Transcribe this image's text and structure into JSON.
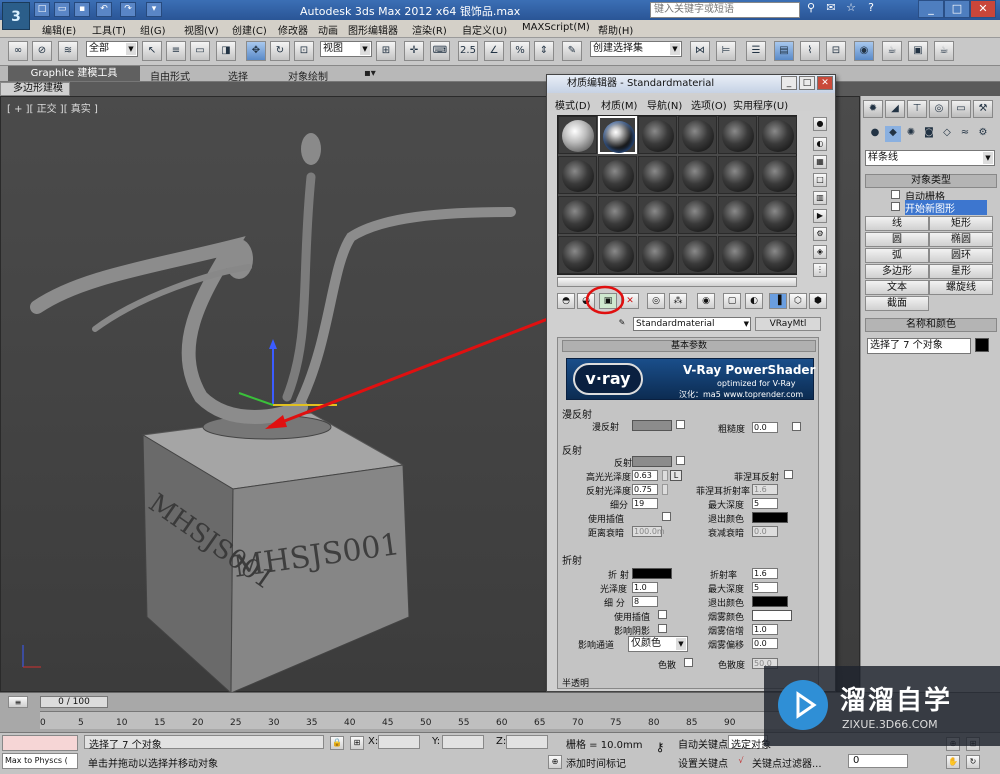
{
  "window": {
    "title": "Autodesk 3ds Max  2012 x64      银饰品.max",
    "search_placeholder": "键入关键字或短语"
  },
  "menu": [
    "编辑(E)",
    "工具(T)",
    "组(G)",
    "视图(V)",
    "创建(C)",
    "修改器",
    "动画",
    "图形编辑器",
    "渲染(R)",
    "自定义(U)",
    "MAXScript(M)",
    "帮助(H)"
  ],
  "toolbar": {
    "filter": "全部",
    "view": "视图",
    "snap_value": "2.5",
    "selection_set": "创建选择集"
  },
  "ribbon": {
    "tabs": [
      "Graphite 建模工具",
      "自由形式",
      "选择",
      "对象绘制"
    ],
    "sub": "多边形建模"
  },
  "viewport": {
    "label": "[ + ][ 正交 ][ 真实 ]",
    "box_text_front": "MHSJS001",
    "box_text_side": "MHSJS001"
  },
  "material_editor": {
    "title": "材质编辑器 - Standardmaterial",
    "menu": [
      "模式(D)",
      "材质(M)",
      "导航(N)",
      "选项(O)",
      "实用程序(U)"
    ],
    "material_name": "Standardmaterial",
    "material_type": "VRayMtl",
    "rollout_title": "基本参数",
    "banner": {
      "title": "V-Ray PowerShader",
      "subtitle": "optimized for V-Ray",
      "credit": "汉化：ma5 www.toprender.com",
      "logo": "v·ray"
    },
    "diffuse": {
      "section": "漫反射",
      "diffuse_label": "漫反射",
      "roughness_label": "粗糙度",
      "roughness": "0.0"
    },
    "reflection": {
      "section": "反射",
      "reflect_label": "反射",
      "hilight_gloss_label": "高光光泽度",
      "hilight_gloss": "0.63",
      "l_button": "L",
      "fresnel_label": "菲涅耳反射",
      "refl_gloss_label": "反射光泽度",
      "refl_gloss": "0.75",
      "fresnel_ior_label": "菲涅耳折射率",
      "fresnel_ior": "1.6",
      "subdivs_label": "细分",
      "subdivs": "19",
      "max_depth_label": "最大深度",
      "max_depth": "5",
      "use_interp_label": "使用插值",
      "exit_color_label": "退出颜色",
      "dim_distance_label": "距离衰暗",
      "dim_distance": "100.0m",
      "dim_falloff_label": "衰减衰暗",
      "dim_falloff": "0.0"
    },
    "refraction": {
      "section": "折射",
      "refract_label": "折 射",
      "ior_label": "折射率",
      "ior": "1.6",
      "gloss_label": "光泽度",
      "gloss": "1.0",
      "max_depth_label": "最大深度",
      "max_depth": "5",
      "subdivs_label": "细 分",
      "subdivs": "8",
      "exit_color_label": "退出颜色",
      "use_interp_label": "使用插值",
      "fog_color_label": "烟雾颜色",
      "affect_shadows_label": "影响阴影",
      "fog_mult_label": "烟雾倍增",
      "fog_mult": "1.0",
      "affect_channels_label": "影响通道",
      "affect_channels": "仅颜色",
      "fog_bias_label": "烟雾偏移",
      "fog_bias": "0.0",
      "dispersion_label": "色散",
      "abbe_label": "色散度",
      "abbe": "50.0"
    },
    "bottom_label": "半透明"
  },
  "command_panel": {
    "dropdown": "样条线",
    "object_type_title": "对象类型",
    "autogrid_label": "自动栅格",
    "start_new_shape_label": "开始新图形",
    "buttons": [
      "线",
      "矩形",
      "圆",
      "椭圆",
      "弧",
      "圆环",
      "多边形",
      "星形",
      "文本",
      "螺旋线",
      "截面"
    ],
    "name_color_title": "名称和颜色",
    "name_value": "选择了 7 个对象"
  },
  "timeline": {
    "slider": "0 / 100",
    "ticks": [
      "0",
      "5",
      "10",
      "15",
      "20",
      "25",
      "30",
      "35",
      "40",
      "45",
      "50",
      "55",
      "60",
      "65",
      "70",
      "75",
      "80",
      "85",
      "90"
    ]
  },
  "status": {
    "maxscript": "Max to Physcs (",
    "selected": "选择了 7 个对象",
    "prompt": "单击并拖动以选择并移动对象",
    "x_label": "X:",
    "y_label": "Y:",
    "z_label": "Z:",
    "grid": "栅格 = 10.0mm",
    "add_time_tag": "添加时间标记",
    "auto_key": "自动关键点",
    "selected_object": "选定对象",
    "set_key": "设置关键点",
    "key_filters": "关键点过滤器...",
    "frame": "0"
  },
  "watermark": {
    "title": "溜溜自学",
    "url": "ZIXUE.3D66.COM"
  },
  "colors": {
    "title_bar": "#2a5596",
    "annotation_red": "#e01010",
    "vray_blue": "#1a4e8a"
  }
}
